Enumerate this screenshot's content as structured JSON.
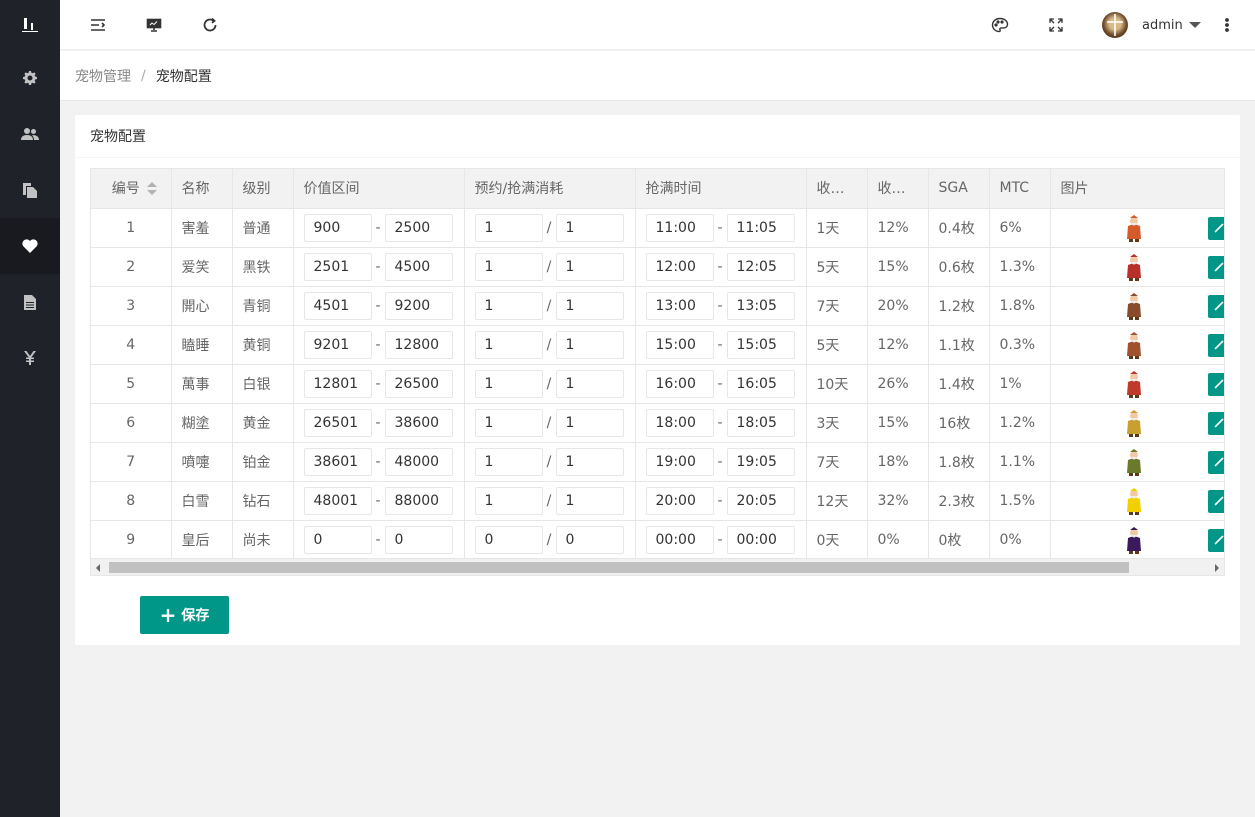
{
  "header": {
    "user_name": "admin"
  },
  "breadcrumb": {
    "parent": "宠物管理",
    "separator": "/",
    "current": "宠物配置"
  },
  "card": {
    "title": "宠物配置"
  },
  "table": {
    "columns": [
      "编号",
      "名称",
      "级别",
      "价值区间",
      "预约/抢满消耗",
      "抢满时间",
      "收益天数",
      "收益比例",
      "SGA",
      "MTC",
      "图片"
    ],
    "rows": [
      {
        "id": "1",
        "name": "害羞",
        "level": "普通",
        "v_min": "900",
        "v_max": "2500",
        "c_a": "1",
        "c_b": "1",
        "t_start": "11:00",
        "t_end": "11:05",
        "days": "1天",
        "rate": "12%",
        "sga": "0.4枚",
        "mtc": "6%",
        "color": "#d35c2a"
      },
      {
        "id": "2",
        "name": "爱笑",
        "level": "黑铁",
        "v_min": "2501",
        "v_max": "4500",
        "c_a": "1",
        "c_b": "1",
        "t_start": "12:00",
        "t_end": "12:05",
        "days": "5天",
        "rate": "15%",
        "sga": "0.6枚",
        "mtc": "1.3%",
        "color": "#b8302a"
      },
      {
        "id": "3",
        "name": "開心",
        "level": "青铜",
        "v_min": "4501",
        "v_max": "9200",
        "c_a": "1",
        "c_b": "1",
        "t_start": "13:00",
        "t_end": "13:05",
        "days": "7天",
        "rate": "20%",
        "sga": "1.2枚",
        "mtc": "1.8%",
        "color": "#8a4b2a"
      },
      {
        "id": "4",
        "name": "瞌睡",
        "level": "黄铜",
        "v_min": "9201",
        "v_max": "12800",
        "c_a": "1",
        "c_b": "1",
        "t_start": "15:00",
        "t_end": "15:05",
        "days": "5天",
        "rate": "12%",
        "sga": "1.1枚",
        "mtc": "0.3%",
        "color": "#a0522d"
      },
      {
        "id": "5",
        "name": "萬事",
        "level": "白银",
        "v_min": "12801",
        "v_max": "26500",
        "c_a": "1",
        "c_b": "1",
        "t_start": "16:00",
        "t_end": "16:05",
        "days": "10天",
        "rate": "26%",
        "sga": "1.4枚",
        "mtc": "1%",
        "color": "#c0392b"
      },
      {
        "id": "6",
        "name": "糊塗",
        "level": "黄金",
        "v_min": "26501",
        "v_max": "38600",
        "c_a": "1",
        "c_b": "1",
        "t_start": "18:00",
        "t_end": "18:05",
        "days": "3天",
        "rate": "15%",
        "sga": "16枚",
        "mtc": "1.2%",
        "color": "#c8a030"
      },
      {
        "id": "7",
        "name": "噴嚏",
        "level": "铂金",
        "v_min": "38601",
        "v_max": "48000",
        "c_a": "1",
        "c_b": "1",
        "t_start": "19:00",
        "t_end": "19:05",
        "days": "7天",
        "rate": "18%",
        "sga": "1.8枚",
        "mtc": "1.1%",
        "color": "#6b7a2a"
      },
      {
        "id": "8",
        "name": "白雪",
        "level": "钻石",
        "v_min": "48001",
        "v_max": "88000",
        "c_a": "1",
        "c_b": "1",
        "t_start": "20:00",
        "t_end": "20:05",
        "days": "12天",
        "rate": "32%",
        "sga": "2.3枚",
        "mtc": "1.5%",
        "color": "#f2d000"
      },
      {
        "id": "9",
        "name": "皇后",
        "level": "尚未",
        "v_min": "0",
        "v_max": "0",
        "c_a": "0",
        "c_b": "0",
        "t_start": "00:00",
        "t_end": "00:00",
        "days": "0天",
        "rate": "0%",
        "sga": "0枚",
        "mtc": "0%",
        "color": "#3a1a5c"
      }
    ]
  },
  "save": {
    "label": "保存"
  }
}
